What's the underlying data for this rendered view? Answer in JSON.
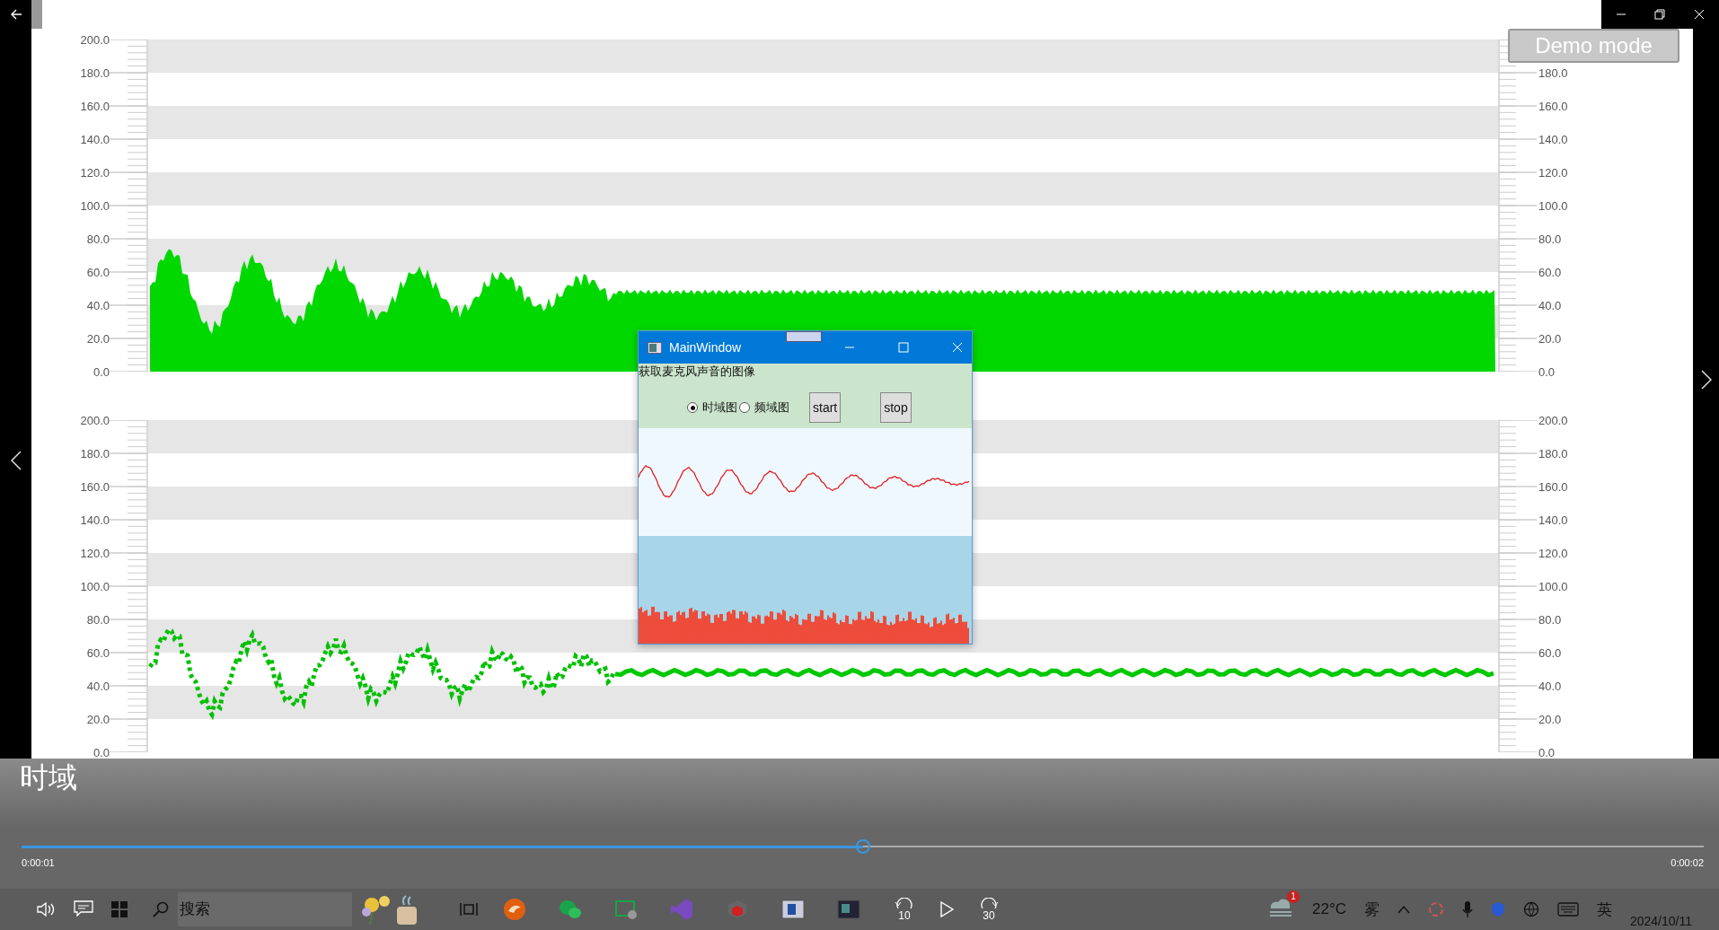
{
  "demo_button": {
    "label": "Demo mode"
  },
  "charts": [
    {
      "kind": "area",
      "left_ticks": [
        "200.0",
        "180.0",
        "160.0",
        "140.0",
        "120.0",
        "100.0",
        "80.0",
        "60.0",
        "40.0",
        "20.0",
        "0.0"
      ],
      "right_ticks": [
        "180.0",
        "160.0",
        "140.0",
        "120.0",
        "100.0",
        "80.0",
        "60.0",
        "40.0",
        "20.0",
        "0.0"
      ]
    },
    {
      "kind": "dots",
      "left_ticks": [
        "200.0",
        "180.0",
        "160.0",
        "140.0",
        "120.0",
        "100.0",
        "80.0",
        "60.0",
        "40.0",
        "20.0",
        "0.0"
      ],
      "right_ticks": [
        "200.0",
        "180.0",
        "160.0",
        "140.0",
        "120.0",
        "100.0",
        "80.0",
        "60.0",
        "40.0",
        "20.0",
        "0.0"
      ]
    }
  ],
  "dialog": {
    "title": "MainWindow",
    "heading": "获取麦克风声音的图像",
    "radios": [
      {
        "label": "时域图",
        "selected": true
      },
      {
        "label": "频域图",
        "selected": false
      }
    ],
    "buttons": [
      "start",
      "stop"
    ]
  },
  "caption": "时域",
  "player": {
    "level": 0.5,
    "elapsed": "0:00:01",
    "total": "0:00:02",
    "skip_back": "10",
    "skip_forward": "30"
  },
  "taskbar": {
    "search_placeholder": "搜索",
    "weather_badge": "1",
    "temperature": "22°C",
    "weather": "雾",
    "ime": "英",
    "date": "2024/10/11"
  }
}
